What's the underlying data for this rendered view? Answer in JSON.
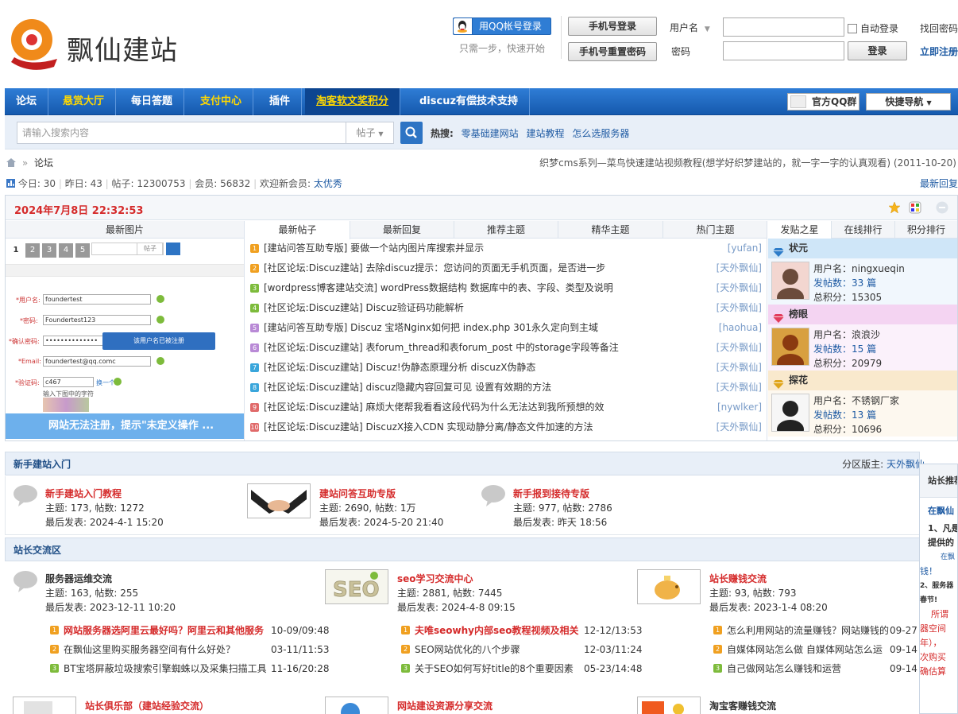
{
  "header": {
    "logo_text": "飘仙建站",
    "qq_login": "用QQ帐号登录",
    "qq_note": "只需一步，快速开始",
    "phone_login": "手机号登录",
    "phone_reset": "手机号重置密码",
    "username_label": "用户名",
    "password_label": "密码",
    "auto_login": "自动登录",
    "login_button": "登录",
    "find_password": "找回密码",
    "register": "立即注册"
  },
  "nav": {
    "items": [
      "论坛",
      "悬赏大厅",
      "每日答题",
      "支付中心",
      "插件",
      "淘客软文奖积分",
      "discuz有偿技术支持"
    ],
    "qq_group": "官方QQ群",
    "quick_nav": "快捷导航"
  },
  "search": {
    "placeholder": "请输入搜索内容",
    "type": "帖子",
    "hot_label": "热搜:",
    "hot": [
      "零基础建网站",
      "建站教程",
      "怎么选服务器"
    ]
  },
  "breadcrumb": {
    "current": "论坛"
  },
  "announcement": "织梦cms系列—菜鸟快速建站视频教程(想学好织梦建站的，就一字一字的认真观看) (2011-10-20)",
  "stats": {
    "today_label": "今日:",
    "today": "30",
    "yesterday_label": "昨日:",
    "yesterday": "43",
    "posts_label": "帖子:",
    "posts": "12300753",
    "members_label": "会员:",
    "members": "56832",
    "welcome_label": "欢迎新会员:",
    "newest_member": "太优秀",
    "latest_reply": "最新回复"
  },
  "portal": {
    "datetime": "2024年7月8日 22:32:53",
    "image_column_title": "最新图片",
    "slide_pages": [
      "1",
      "2",
      "3",
      "4",
      "5"
    ],
    "slide_caption": "网站无法注册，提示\"未定义操作 ...",
    "slide_form": {
      "type_label": "帖子",
      "labels": [
        "*用户名:",
        "*密码:",
        "*确认密码:",
        "*Email:",
        "*验证码:"
      ],
      "values": [
        "foundertest",
        "Foundertest123",
        "••••••••••••••",
        "foundertest@qq.comc",
        "c467"
      ],
      "tooltip": "该用户名已被注册",
      "captcha_refresh": "换一个",
      "captcha_hint": "输入下图中的字符"
    },
    "post_tabs": [
      "最新帖子",
      "最新回复",
      "推荐主题",
      "精华主题",
      "热门主题"
    ],
    "posts": [
      {
        "n": "1",
        "color": "#f0a020",
        "title": "[建站问答互助专版] 要做一个站内图片库搜索并显示",
        "author": "[yufan]"
      },
      {
        "n": "2",
        "color": "#f0a020",
        "title": "[社区论坛:Discuz建站] 去除discuz提示：您访问的页面无手机页面，是否进一步",
        "author": "[天外飘仙]"
      },
      {
        "n": "3",
        "color": "#7dbb3b",
        "title": "[wordpress博客建站交流] wordPress数据结构 数据库中的表、字段、类型及说明",
        "author": "[天外飘仙]"
      },
      {
        "n": "4",
        "color": "#7dbb3b",
        "title": "[社区论坛:Discuz建站] Discuz验证码功能解析",
        "author": "[天外飘仙]"
      },
      {
        "n": "5",
        "color": "#b98ad6",
        "title": "[建站问答互助专版] Discuz 宝塔Nginx如何把 index.php 301永久定向到主域",
        "author": "[haohua]"
      },
      {
        "n": "6",
        "color": "#b98ad6",
        "title": "[社区论坛:Discuz建站] 表forum_thread和表forum_post 中的storage字段等备注",
        "author": "[天外飘仙]"
      },
      {
        "n": "7",
        "color": "#3aa6db",
        "title": "[社区论坛:Discuz建站] Discuz!伪静态原理分析 discuzX伪静态",
        "author": "[天外飘仙]"
      },
      {
        "n": "8",
        "color": "#3aa6db",
        "title": "[社区论坛:Discuz建站] discuz隐藏内容回复可见 设置有效期的方法",
        "author": "[天外飘仙]"
      },
      {
        "n": "9",
        "color": "#e06a6a",
        "title": "[社区论坛:Discuz建站] 麻烦大佬帮我看看这段代码为什么无法达到我所预想的效",
        "author": "[nywlker]"
      },
      {
        "n": "10",
        "color": "#e06a6a",
        "title": "[社区论坛:Discuz建站] DiscuzX接入CDN 实现动静分离/静态文件加速的方法",
        "author": "[天外飘仙]"
      }
    ],
    "star_tabs": [
      "发贴之星",
      "在线排行",
      "积分排行"
    ],
    "stars": [
      {
        "rank": "状元",
        "bg": "#cfe6f8",
        "user_label": "用户名：",
        "user": "ningxueqin",
        "posts_label": "发帖数：",
        "posts": "33 篇",
        "score_label": "总积分：",
        "score": "15305"
      },
      {
        "rank": "榜眼",
        "bg": "#f4d4f2",
        "user_label": "用户名：",
        "user": "浪浪沙",
        "posts_label": "发帖数：",
        "posts": "15 篇",
        "score_label": "总积分：",
        "score": "20979"
      },
      {
        "rank": "探花",
        "bg": "#f9e9cd",
        "user_label": "用户名：",
        "user": "不锈钢厂家",
        "posts_label": "发帖数：",
        "posts": "13 篇",
        "score_label": "总积分：",
        "score": "10696"
      }
    ]
  },
  "section_newbie": {
    "title": "新手建站入门",
    "moderator_label": "分区版主:",
    "moderator": "天外飘仙",
    "forums": [
      {
        "name": "新手建站入门教程",
        "stats": "主题: 173, 帖数: 1272",
        "last": "最后发表: 2024-4-1 15:20"
      },
      {
        "name": "建站问答互助专版",
        "stats": "主题: 2690, 帖数: 1万",
        "last": "最后发表: 2024-5-20 21:40"
      },
      {
        "name": "新手报到接待专版",
        "stats": "主题: 977, 帖数: 2786",
        "last": "最后发表: 昨天 18:56"
      }
    ]
  },
  "section_exchange": {
    "title": "站长交流区",
    "forums": [
      {
        "name": "服务器运维交流",
        "stats": "主题: 163, 帖数: 255",
        "last": "最后发表: 2023-12-11 10:20"
      },
      {
        "name": "seo学习交流中心",
        "stats": "主题: 2881, 帖数: 7445",
        "last": "最后发表: 2024-4-8 09:15"
      },
      {
        "name": "站长赚钱交流",
        "stats": "主题: 93, 帖数: 793",
        "last": "最后发表: 2023-1-4 08:20"
      }
    ],
    "threads": [
      [
        {
          "n": "1",
          "color": "#f0a020",
          "title": "网站服务器选阿里云最好吗？阿里云和其他服务",
          "date": "10-09/09:48",
          "red": true
        },
        {
          "n": "2",
          "color": "#f0a020",
          "title": "在飘仙这里购买服务器空间有什么好处？",
          "date": "03-11/11:53",
          "red": false
        },
        {
          "n": "3",
          "color": "#7dbb3b",
          "title": "BT宝塔屏蔽垃圾搜索引擎蜘蛛以及采集扫描工具",
          "date": "11-16/20:28",
          "red": false
        }
      ],
      [
        {
          "n": "1",
          "color": "#f0a020",
          "title": "夫唯seowhy内部seo教程视频及相关",
          "date": "12-12/13:53",
          "red": true
        },
        {
          "n": "2",
          "color": "#f0a020",
          "title": "SEO网站优化的八个步骤",
          "date": "12-03/11:24",
          "red": false
        },
        {
          "n": "3",
          "color": "#7dbb3b",
          "title": "关于SEO如何写好title的8个重要因素",
          "date": "05-23/14:48",
          "red": false
        }
      ],
      [
        {
          "n": "1",
          "color": "#f0a020",
          "title": "怎么利用网站的流量赚钱？网站赚钱的",
          "date": "09-27",
          "red": false
        },
        {
          "n": "2",
          "color": "#f0a020",
          "title": "自媒体网站怎么做 自媒体网站怎么运",
          "date": "09-14",
          "red": false
        },
        {
          "n": "3",
          "color": "#7dbb3b",
          "title": "自己做网站怎么赚钱和运营",
          "date": "09-14",
          "red": false
        }
      ]
    ],
    "forums_more": [
      "站长俱乐部（建站经验交流）",
      "网站建设资源分享交流",
      "淘宝客赚钱交流"
    ]
  },
  "side_panel": {
    "title": "站长推荐",
    "lines": [
      "在飘仙",
      "1、凡是",
      "提供的",
      "在飘",
      "钱！",
      "2、服务器",
      "春节!",
      "所谓",
      "器空间",
      "年），",
      "次购买",
      "确估算"
    ]
  }
}
